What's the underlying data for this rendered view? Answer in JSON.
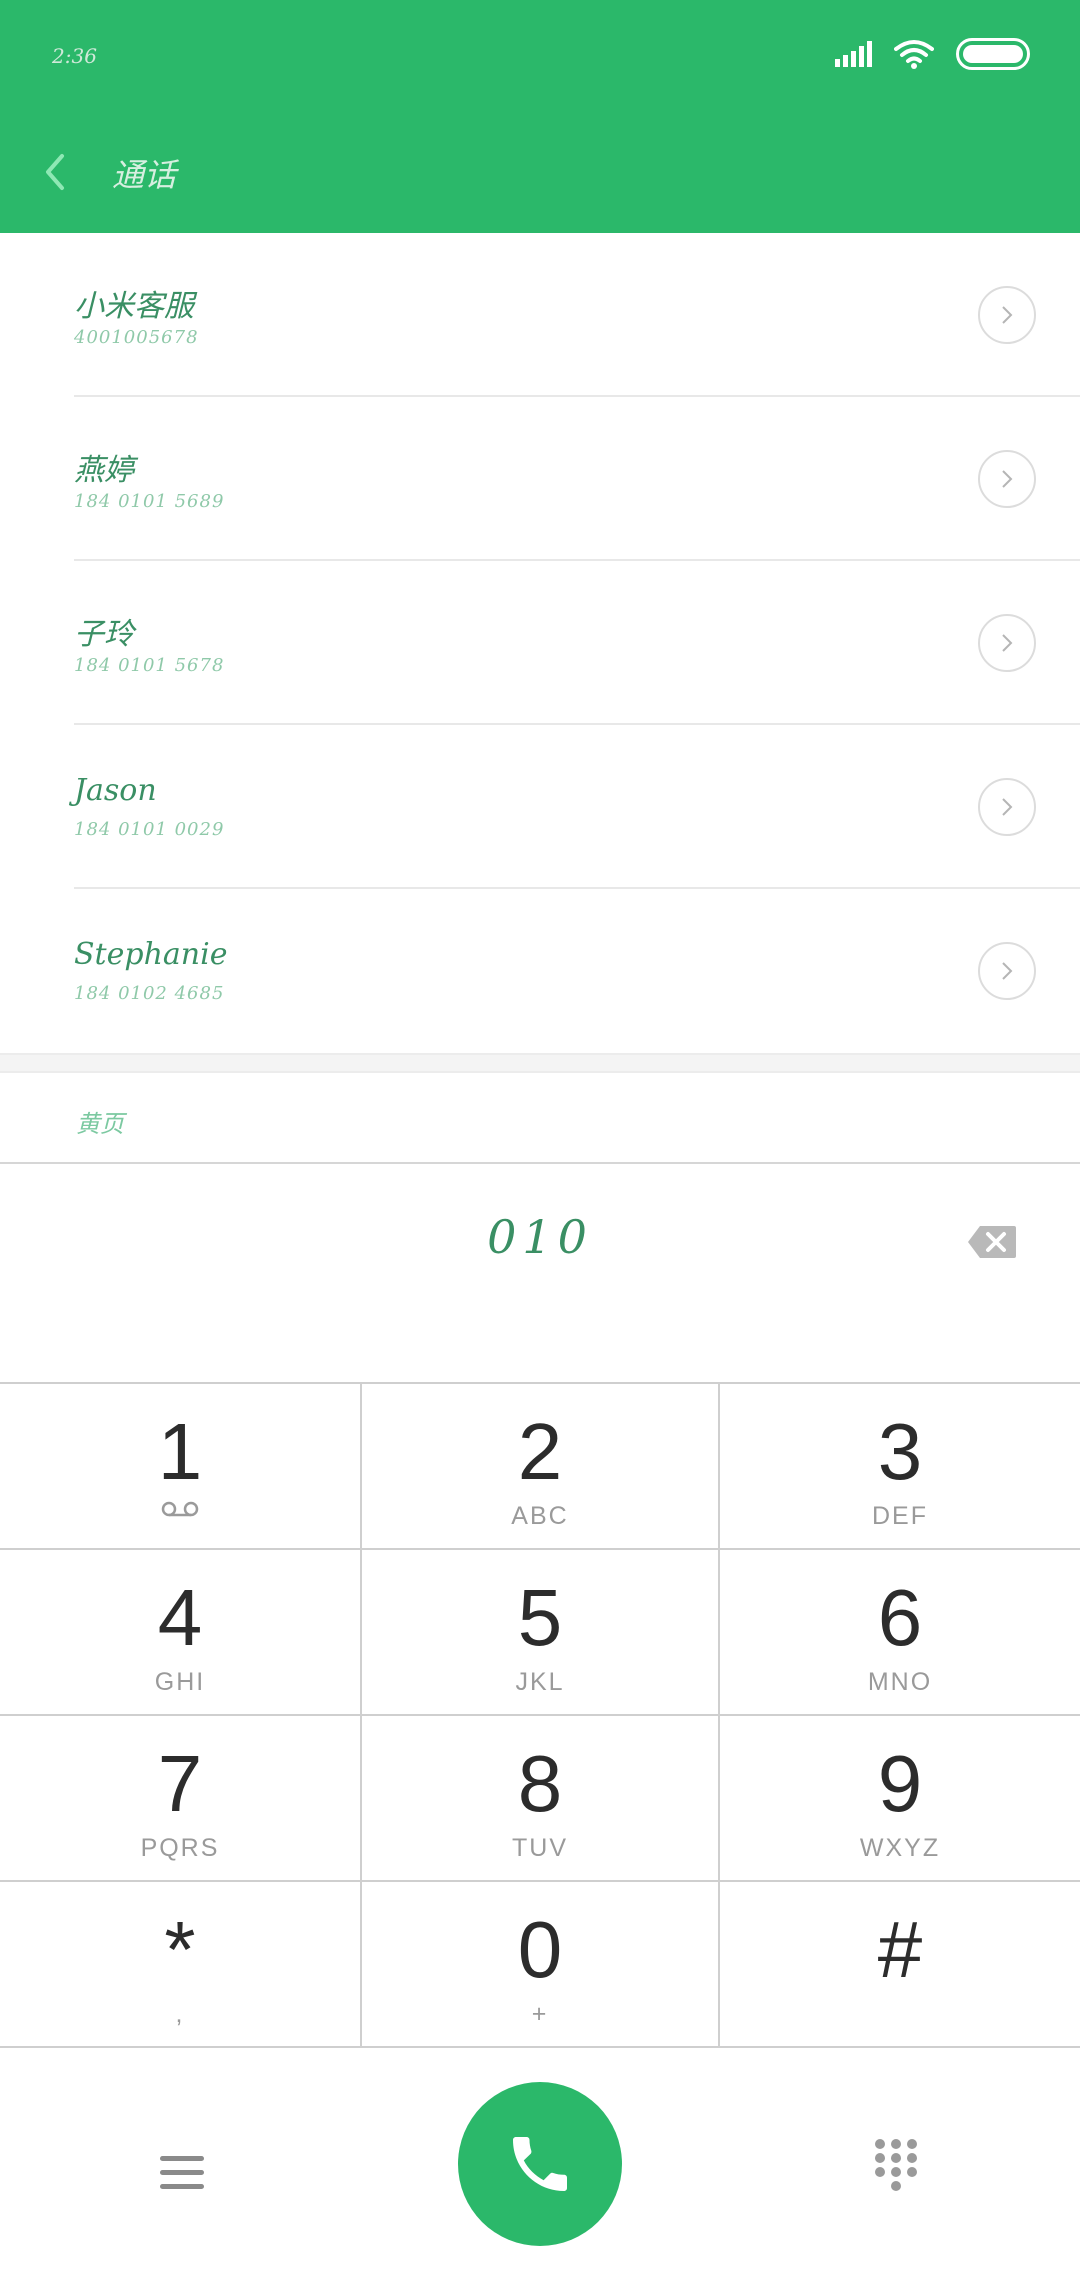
{
  "status_bar": {
    "time": "2:36"
  },
  "header": {
    "title": "通话"
  },
  "contacts": [
    {
      "name": "小米客服",
      "number": "4001005678"
    },
    {
      "name": "燕婷",
      "number": "184 0101 5689"
    },
    {
      "name": "子玲",
      "number": "184 0101 5678"
    },
    {
      "name": "Jason",
      "number": "184 0101 0029"
    },
    {
      "name": "Stephanie",
      "number": "184 0102 4685"
    }
  ],
  "more_label": "黄页",
  "dialed_number": "010",
  "keypad": {
    "k1": {
      "digit": "1",
      "letters": ""
    },
    "k2": {
      "digit": "2",
      "letters": "ABC"
    },
    "k3": {
      "digit": "3",
      "letters": "DEF"
    },
    "k4": {
      "digit": "4",
      "letters": "GHI"
    },
    "k5": {
      "digit": "5",
      "letters": "JKL"
    },
    "k6": {
      "digit": "6",
      "letters": "MNO"
    },
    "k7": {
      "digit": "7",
      "letters": "PQRS"
    },
    "k8": {
      "digit": "8",
      "letters": "TUV"
    },
    "k9": {
      "digit": "9",
      "letters": "WXYZ"
    },
    "kstar": {
      "digit": "*",
      "letters": ","
    },
    "k0": {
      "digit": "0",
      "letters": "+"
    },
    "khash": {
      "digit": "#",
      "letters": ""
    }
  },
  "colors": {
    "accent": "#2bb86a",
    "name_text": "#3a8f64",
    "number_text": "#8fc9a9"
  },
  "icons": {
    "back": "chevron-left-icon",
    "voicemail": "voicemail-icon",
    "backspace": "backspace-icon",
    "call": "phone-icon",
    "menu": "menu-icon",
    "dialpad": "dialpad-icon"
  }
}
